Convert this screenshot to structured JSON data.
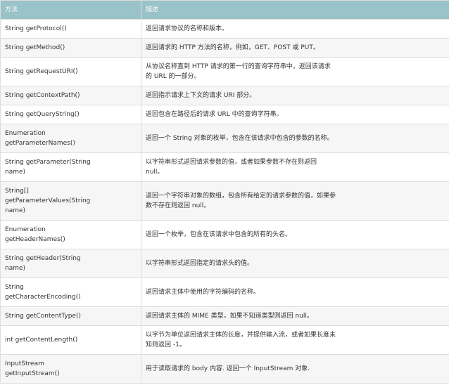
{
  "table": {
    "headers": [
      "方法",
      "描述"
    ],
    "rows": [
      {
        "method": "String getProtocol()",
        "desc": "返回请求协议的名称和版本。"
      },
      {
        "method": "String getMethod()",
        "desc": "返回请求的 HTTP 方法的名称，例如，GET、POST 或 PUT。"
      },
      {
        "method": "String getRequestURI()",
        "desc": "从协议名称直到 HTTP 请求的第一行的查询字符串中，返回该请求的 URL 的一部分。"
      },
      {
        "method": "String getContextPath()",
        "desc": "返回指示请求上下文的请求 URI 部分。"
      },
      {
        "method": "String getQueryString()",
        "desc": "返回包含在路径后的请求 URL 中的查询字符串。"
      },
      {
        "method": "Enumeration getParameterNames()",
        "desc": "返回一个 String 对象的枚举，包含在该请求中包含的参数的名称。"
      },
      {
        "method": "String getParameter(String name)",
        "desc": "以字符串形式返回请求参数的值，或者如果参数不存在则返回 null。"
      },
      {
        "method": "String[] getParameterValues(String name)",
        "desc": "返回一个字符串对象的数组，包含所有给定的请求参数的值，如果参数不存在则返回 null。"
      },
      {
        "method": "Enumeration getHeaderNames()",
        "desc": "返回一个枚举，包含在该请求中包含的所有的头名。"
      },
      {
        "method": "String getHeader(String name)",
        "desc": "以字符串形式返回指定的请求头的值。"
      },
      {
        "method": "String getCharacterEncoding()",
        "desc": "返回请求主体中使用的字符编码的名称。"
      },
      {
        "method": "String getContentType()",
        "desc": "返回请求主体的 MIME 类型，如果不知道类型则返回 null。"
      },
      {
        "method": "int getContentLength()",
        "desc": "以字节为单位返回请求主体的长度，并提供输入流，或者如果长度未知则返回 -1。"
      },
      {
        "method": "InputStream getInputStream()",
        "desc": "用于读取请求的 body 内容. 返回一个 InputStream 对象."
      }
    ]
  },
  "colors": {
    "header_bg": "#9ac2c9",
    "header_text": "#ffffff",
    "row_odd_bg": "#ffffff",
    "row_even_bg": "#f6f6f6",
    "border": "#dddddd",
    "text": "#333333"
  }
}
